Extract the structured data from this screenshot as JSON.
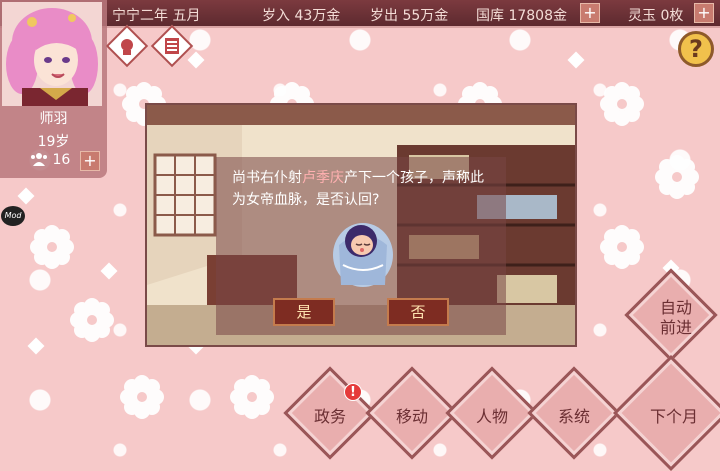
{
  "top_bar": {
    "date": "宁宁二年 五月",
    "income": "岁入 43万金",
    "expense": "岁出 55万金",
    "treasury": "国库 17808金",
    "jade": "灵玉 0枚",
    "plus": "+"
  },
  "character": {
    "name": "师羽",
    "age": "19岁",
    "stat_value": "16",
    "plus": "+"
  },
  "help": "?",
  "mod_label": "Mod",
  "dialog": {
    "text_pre": "尚书右仆射",
    "text_name": "卢季庆",
    "text_post": "产下一个孩子，声称此为女帝血脉，是否认回?",
    "yes": "是",
    "no": "否"
  },
  "nav": {
    "auto_advance": "自动前进",
    "politics": "政务",
    "politics_badge": "!",
    "move": "移动",
    "people": "人物",
    "system": "系统",
    "next_month": "下个月"
  },
  "colors": {
    "background": "#f6c9c9",
    "top_bar": "#6d3035",
    "button_dark": "#7e2c22",
    "nav_diamond": "#e9aeae"
  }
}
